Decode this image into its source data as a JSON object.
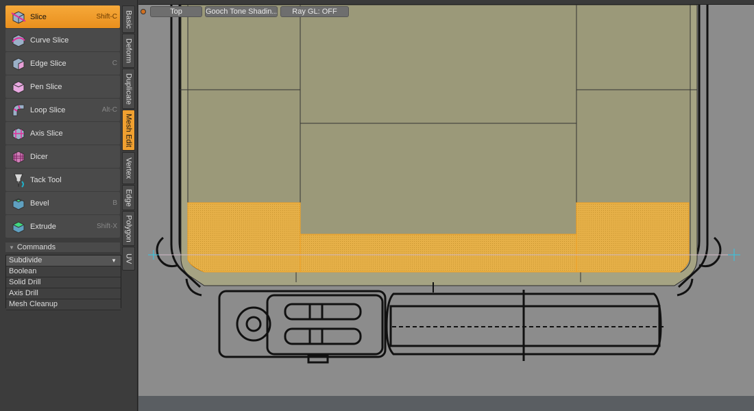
{
  "tools": [
    {
      "label": "Slice",
      "shortcut": "Shift-C",
      "icon": "slice-icon",
      "active": true
    },
    {
      "label": "Curve Slice",
      "shortcut": "",
      "icon": "curve-slice-icon",
      "active": false
    },
    {
      "label": "Edge Slice",
      "shortcut": "C",
      "icon": "edge-slice-icon",
      "active": false
    },
    {
      "label": "Pen Slice",
      "shortcut": "",
      "icon": "pen-slice-icon",
      "active": false
    },
    {
      "label": "Loop Slice",
      "shortcut": "Alt-C",
      "icon": "loop-slice-icon",
      "active": false
    },
    {
      "label": "Axis Slice",
      "shortcut": "",
      "icon": "axis-slice-icon",
      "active": false
    },
    {
      "label": "Dicer",
      "shortcut": "",
      "icon": "dicer-icon",
      "active": false
    },
    {
      "label": "Tack Tool",
      "shortcut": "",
      "icon": "tack-tool-icon",
      "active": false
    },
    {
      "label": "Bevel",
      "shortcut": "B",
      "icon": "bevel-icon",
      "active": false
    },
    {
      "label": "Extrude",
      "shortcut": "Shift-X",
      "icon": "extrude-icon",
      "active": false
    }
  ],
  "tabs": [
    {
      "label": "Basic",
      "active": false
    },
    {
      "label": "Deform",
      "active": false
    },
    {
      "label": "Duplicate",
      "active": false
    },
    {
      "label": "Mesh Edit",
      "active": true
    },
    {
      "label": "Vertex",
      "active": false
    },
    {
      "label": "Edge",
      "active": false
    },
    {
      "label": "Polygon",
      "active": false
    },
    {
      "label": "UV",
      "active": false
    }
  ],
  "commands": {
    "header": "Commands",
    "selected": "Subdivide",
    "items": [
      "Boolean",
      "Solid Drill",
      "Axis Drill",
      "Mesh Cleanup"
    ]
  },
  "viewport": {
    "view_label": "Top",
    "shading_label": "Gooch Tone Shadin...",
    "raygl_label": "Ray GL: OFF"
  },
  "colors": {
    "accent": "#f0a030",
    "mesh_fill": "#9c9a7a",
    "selection": "#e8b040",
    "background": "#8c8c8c"
  }
}
